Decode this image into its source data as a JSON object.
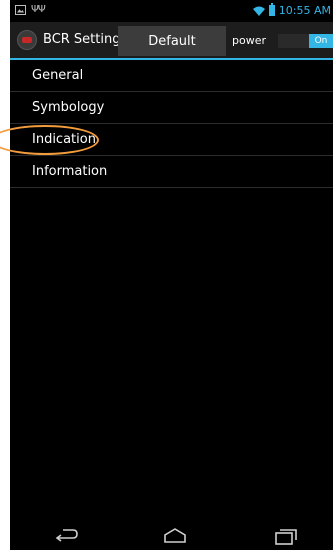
{
  "status_bar": {
    "time": "10:55 AM",
    "icons": [
      "image-icon",
      "usb-icon",
      "wifi-icon",
      "battery-icon"
    ]
  },
  "action_bar": {
    "app_icon": "barcode-reader-icon",
    "title": "BCR Settings",
    "profile_value": "Default",
    "power_label": "power",
    "power_toggle": "On"
  },
  "menu": {
    "items": [
      {
        "label": "General"
      },
      {
        "label": "Symbology"
      },
      {
        "label": "Indication"
      },
      {
        "label": "Information"
      }
    ]
  },
  "navigation": {
    "icons": [
      "back-icon",
      "home-icon",
      "recent-apps-icon"
    ]
  },
  "colors": {
    "accent": "#33b5e5",
    "highlight": "#f39c3d",
    "background": "#000000"
  }
}
